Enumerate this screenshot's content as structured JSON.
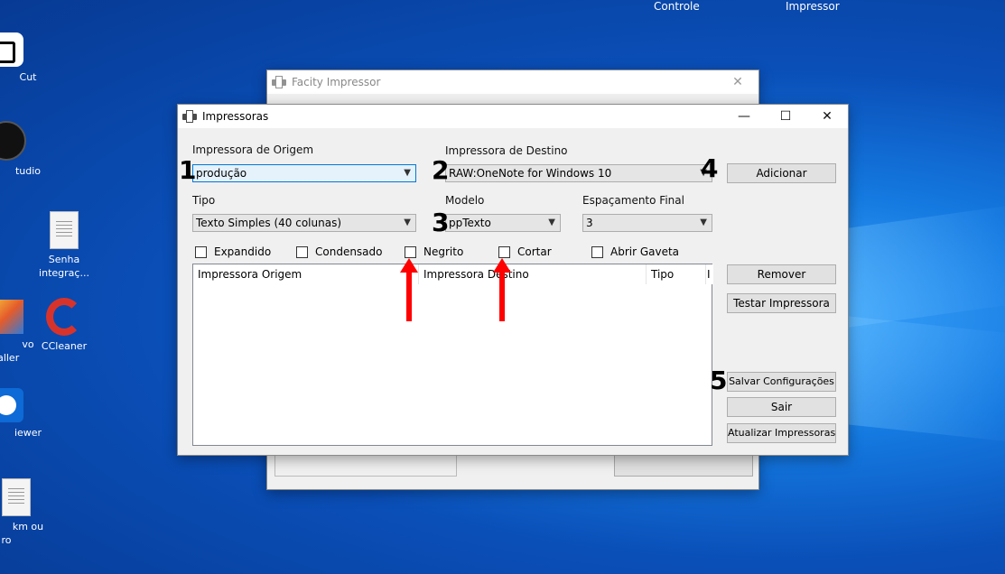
{
  "desktop": {
    "top_labels": [
      "Controle",
      "Impressor"
    ],
    "icons": [
      {
        "label": "Cut"
      },
      {
        "label": "tudio"
      },
      {
        "label": "Senha integraç..."
      },
      {
        "label": "vo taller"
      },
      {
        "label": "CCleaner"
      },
      {
        "label": "iewer"
      },
      {
        "label": "km ou ro"
      }
    ]
  },
  "back_window": {
    "title": "Facity Impressor"
  },
  "dialog": {
    "title": "Impressoras",
    "labels": {
      "origem": "Impressora de Origem",
      "destino": "Impressora de Destino",
      "tipo": "Tipo",
      "modelo": "Modelo",
      "espacamento": "Espaçamento Final"
    },
    "values": {
      "origem": "produção",
      "destino": "RAW:OneNote for Windows 10",
      "tipo": "Texto Simples (40 colunas)",
      "modelo": "ppTexto",
      "espacamento": "3"
    },
    "checkboxes": [
      "Expandido",
      "Condensado",
      "Negrito",
      "Cortar",
      "Abrir Gaveta"
    ],
    "columns": [
      "Impressora Origem",
      "Impressora Destino",
      "Tipo",
      "I"
    ],
    "buttons": {
      "adicionar": "Adicionar",
      "remover": "Remover",
      "testar": "Testar Impressora",
      "salvar": "Salvar Configurações",
      "sair": "Sair",
      "atualizar": "Atualizar Impressoras"
    }
  },
  "annotations": {
    "numbers": [
      "1",
      "2",
      "3",
      "4",
      "5"
    ],
    "arrow_color": "#ff0000"
  }
}
